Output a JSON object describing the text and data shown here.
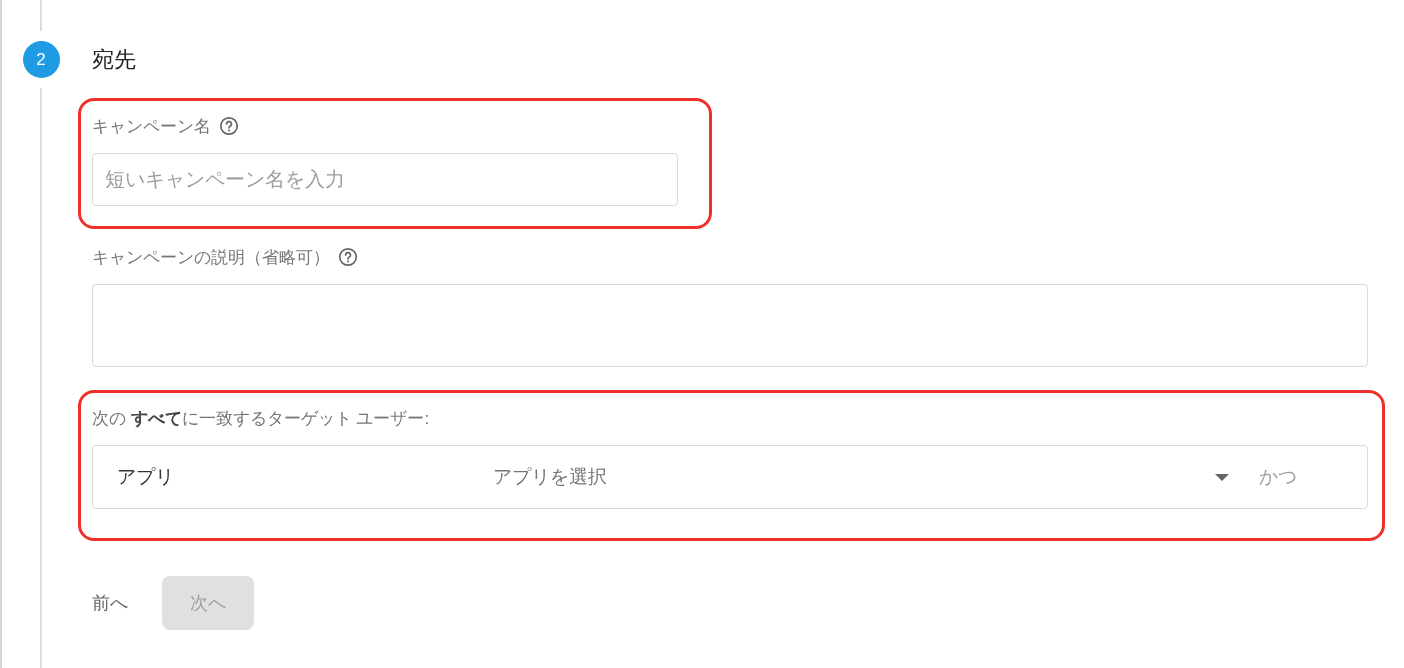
{
  "step": {
    "number": "2",
    "title": "宛先",
    "active": true
  },
  "fields": [
    {
      "kind": "text",
      "label": "キャンペーン名",
      "help": true,
      "placeholder": "短いキャンペーン名を入力",
      "highlighted": true
    },
    {
      "kind": "textarea",
      "label": "キャンペーンの説明（省略可）",
      "help": true,
      "highlighted": false
    },
    {
      "kind": "condition",
      "label": "次の **すべて**に一致するターゲット ユーザー:",
      "row": {
        "type": "アプリ",
        "placeholder": "アプリを選択",
        "conjunction": "かつ"
      },
      "highlighted": true
    }
  ],
  "buttons": [
    {
      "label": "前へ",
      "kind": "text",
      "disabled": false
    },
    {
      "label": "次へ",
      "kind": "filled",
      "disabled": true
    }
  ]
}
